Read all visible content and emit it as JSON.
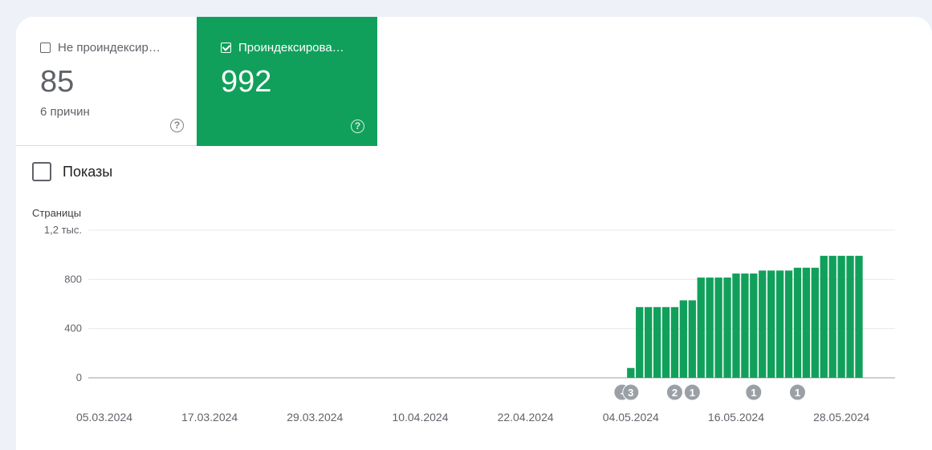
{
  "tiles": {
    "unindexed": {
      "label": "Не проиндексир…",
      "value": "85",
      "sub": "6 причин",
      "checked": false
    },
    "indexed": {
      "label": "Проиндексирова…",
      "value": "992",
      "checked": true
    }
  },
  "impressions_toggle": {
    "label": "Показы",
    "checked": false
  },
  "colors": {
    "accent": "#11a05b",
    "marker": "#9aa0a6"
  },
  "chart_data": {
    "type": "bar",
    "ylabel": "Страницы",
    "ylim": [
      0,
      1200
    ],
    "yticks": [
      {
        "value": 0,
        "label": "0"
      },
      {
        "value": 400,
        "label": "400"
      },
      {
        "value": 800,
        "label": "800"
      },
      {
        "value": 1200,
        "label": "1,2 тыс."
      }
    ],
    "xtick_labels": [
      "05.03.2024",
      "17.03.2024",
      "29.03.2024",
      "10.04.2024",
      "22.04.2024",
      "04.05.2024",
      "16.05.2024",
      "28.05.2024"
    ],
    "x_range": [
      "2024-03-05",
      "2024-06-01"
    ],
    "series": [
      {
        "x": [
          "2024-05-04",
          "2024-05-05",
          "2024-05-06",
          "2024-05-07",
          "2024-05-08",
          "2024-05-09",
          "2024-05-10",
          "2024-05-11",
          "2024-05-12",
          "2024-05-13",
          "2024-05-14",
          "2024-05-15",
          "2024-05-16",
          "2024-05-17",
          "2024-05-18",
          "2024-05-19",
          "2024-05-20",
          "2024-05-21",
          "2024-05-22",
          "2024-05-23",
          "2024-05-24",
          "2024-05-25",
          "2024-05-26",
          "2024-05-27",
          "2024-05-28",
          "2024-05-29",
          "2024-05-30"
        ],
        "values": [
          80,
          575,
          575,
          575,
          575,
          575,
          630,
          630,
          815,
          815,
          815,
          815,
          848,
          848,
          848,
          872,
          872,
          872,
          872,
          895,
          895,
          895,
          992,
          992,
          992,
          992,
          992
        ]
      }
    ],
    "annotations": [
      {
        "date": "2024-05-03",
        "label": "-"
      },
      {
        "date": "2024-05-04",
        "label": "3"
      },
      {
        "date": "2024-05-09",
        "label": "2"
      },
      {
        "date": "2024-05-11",
        "label": "1"
      },
      {
        "date": "2024-05-18",
        "label": "1"
      },
      {
        "date": "2024-05-23",
        "label": "1"
      }
    ]
  }
}
